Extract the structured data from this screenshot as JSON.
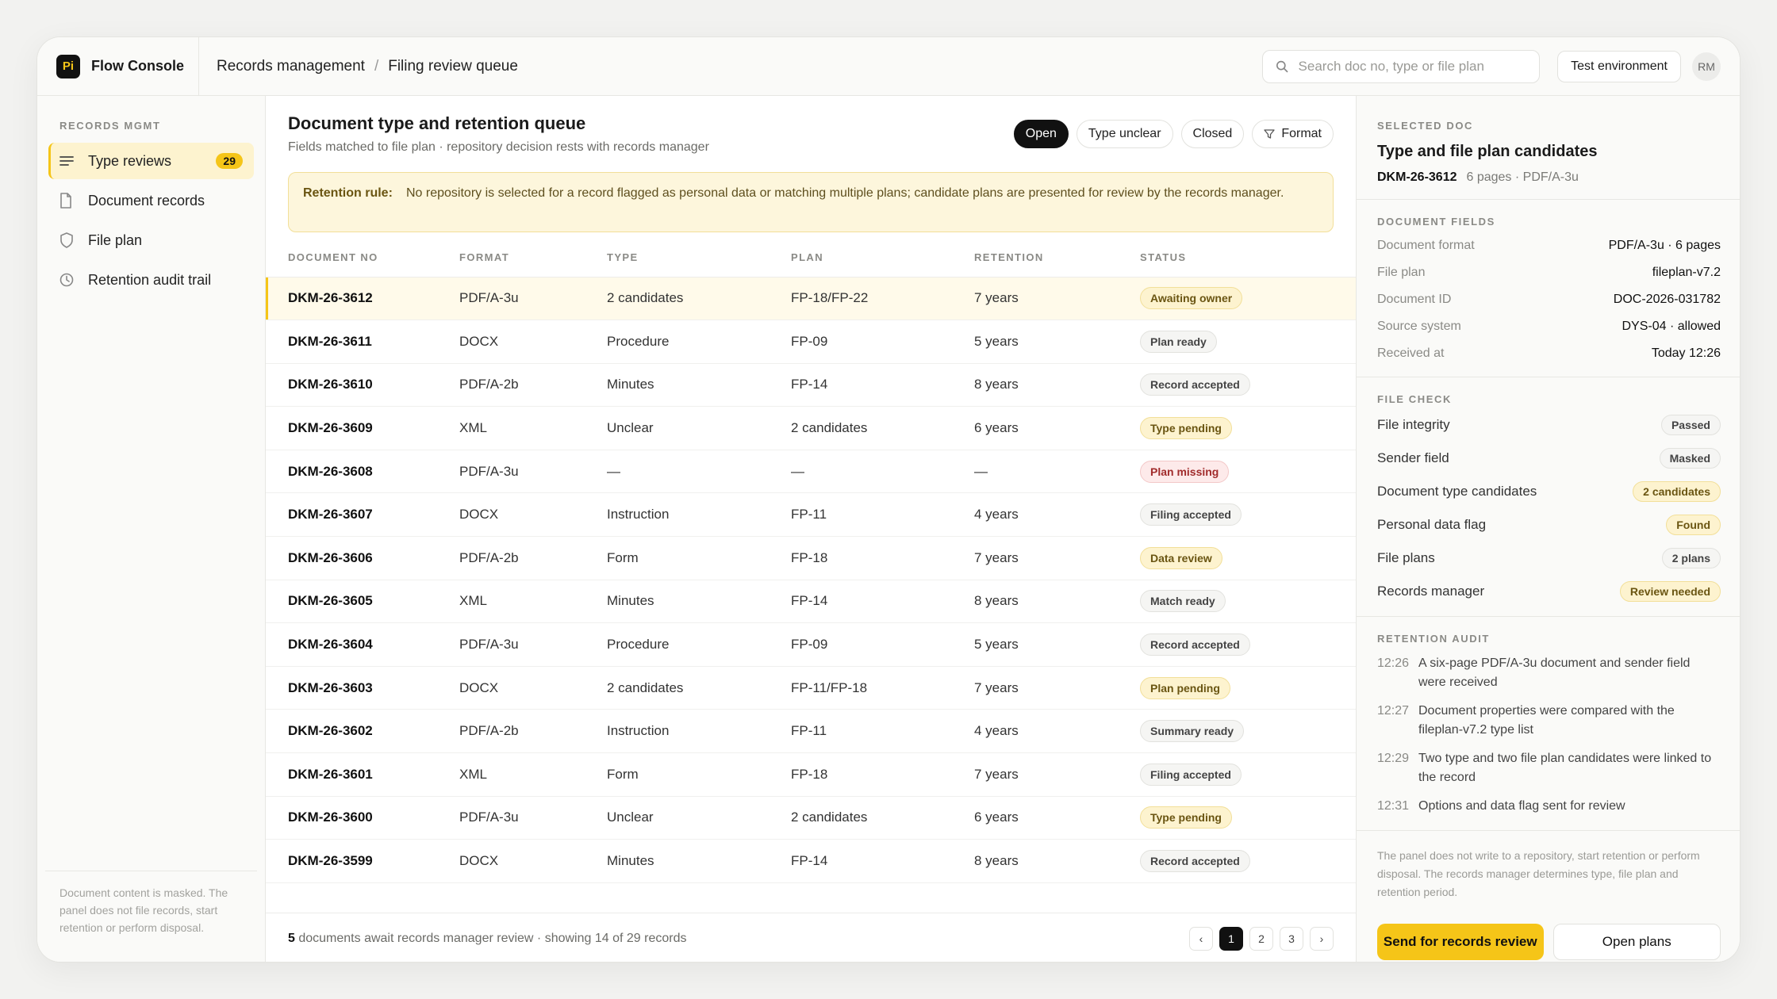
{
  "app": {
    "logo": "Pi",
    "name": "Flow Console"
  },
  "breadcrumb": {
    "root": "Records management",
    "separator": "/",
    "current": "Filing review queue"
  },
  "search": {
    "placeholder": "Search doc no, type or file plan"
  },
  "env_label": "Test environment",
  "avatar_initials": "RM",
  "sidebar": {
    "heading": "RECORDS MGMT",
    "items": [
      {
        "label": "Type reviews",
        "icon": "list-icon",
        "badge": "29",
        "active": true
      },
      {
        "label": "Document records",
        "icon": "document-icon"
      },
      {
        "label": "File plan",
        "icon": "shield-icon"
      },
      {
        "label": "Retention audit trail",
        "icon": "clock-icon"
      }
    ],
    "note": "Document content is masked. The panel does not file records, start retention or perform disposal."
  },
  "main": {
    "title": "Document type and retention queue",
    "subtitle": "Fields matched to file plan · repository decision rests with records manager",
    "filters": [
      "Open",
      "Type unclear",
      "Closed"
    ],
    "format_filter": "Format",
    "rule_label": "Retention rule:",
    "rule_text": "No repository is selected for a record flagged as personal data or matching multiple plans; candidate plans are presented for review by the records manager.",
    "columns": [
      "DOCUMENT NO",
      "FORMAT",
      "TYPE",
      "PLAN",
      "RETENTION",
      "STATUS"
    ],
    "rows": [
      {
        "doc": "DKM-26-3612",
        "format": "PDF/A-3u",
        "type": "2 candidates",
        "plan": "FP-18/FP-22",
        "retention": "7 years",
        "status": "Awaiting owner",
        "tone": "warn"
      },
      {
        "doc": "DKM-26-3611",
        "format": "DOCX",
        "type": "Procedure",
        "plan": "FP-09",
        "retention": "5 years",
        "status": "Plan ready",
        "tone": "neutral"
      },
      {
        "doc": "DKM-26-3610",
        "format": "PDF/A-2b",
        "type": "Minutes",
        "plan": "FP-14",
        "retention": "8 years",
        "status": "Record accepted",
        "tone": "neutral"
      },
      {
        "doc": "DKM-26-3609",
        "format": "XML",
        "type": "Unclear",
        "plan": "2 candidates",
        "retention": "6 years",
        "status": "Type pending",
        "tone": "warn"
      },
      {
        "doc": "DKM-26-3608",
        "format": "PDF/A-3u",
        "type": "—",
        "plan": "—",
        "retention": "—",
        "status": "Plan missing",
        "tone": "danger"
      },
      {
        "doc": "DKM-26-3607",
        "format": "DOCX",
        "type": "Instruction",
        "plan": "FP-11",
        "retention": "4 years",
        "status": "Filing accepted",
        "tone": "neutral"
      },
      {
        "doc": "DKM-26-3606",
        "format": "PDF/A-2b",
        "type": "Form",
        "plan": "FP-18",
        "retention": "7 years",
        "status": "Data review",
        "tone": "warn"
      },
      {
        "doc": "DKM-26-3605",
        "format": "XML",
        "type": "Minutes",
        "plan": "FP-14",
        "retention": "8 years",
        "status": "Match ready",
        "tone": "neutral"
      },
      {
        "doc": "DKM-26-3604",
        "format": "PDF/A-3u",
        "type": "Procedure",
        "plan": "FP-09",
        "retention": "5 years",
        "status": "Record accepted",
        "tone": "neutral"
      },
      {
        "doc": "DKM-26-3603",
        "format": "DOCX",
        "type": "2 candidates",
        "plan": "FP-11/FP-18",
        "retention": "7 years",
        "status": "Plan pending",
        "tone": "warn"
      },
      {
        "doc": "DKM-26-3602",
        "format": "PDF/A-2b",
        "type": "Instruction",
        "plan": "FP-11",
        "retention": "4 years",
        "status": "Summary ready",
        "tone": "neutral"
      },
      {
        "doc": "DKM-26-3601",
        "format": "XML",
        "type": "Form",
        "plan": "FP-18",
        "retention": "7 years",
        "status": "Filing accepted",
        "tone": "neutral"
      },
      {
        "doc": "DKM-26-3600",
        "format": "PDF/A-3u",
        "type": "Unclear",
        "plan": "2 candidates",
        "retention": "6 years",
        "status": "Type pending",
        "tone": "warn"
      },
      {
        "doc": "DKM-26-3599",
        "format": "DOCX",
        "type": "Minutes",
        "plan": "FP-14",
        "retention": "8 years",
        "status": "Record accepted",
        "tone": "neutral"
      }
    ],
    "footer_count": "5",
    "footer_text": " documents await records manager review · showing 14 of 29 records",
    "pages": [
      "1",
      "2",
      "3"
    ],
    "prev": "‹",
    "next": "›"
  },
  "panel": {
    "heading": "SELECTED DOC",
    "title": "Type and file plan candidates",
    "doc_no": "DKM-26-3612",
    "doc_meta": "6 pages · PDF/A-3u",
    "fields_heading": "DOCUMENT FIELDS",
    "fields": [
      {
        "k": "Document format",
        "v": "PDF/A-3u · 6 pages"
      },
      {
        "k": "File plan",
        "v": "fileplan-v7.2"
      },
      {
        "k": "Document ID",
        "v": "DOC-2026-031782"
      },
      {
        "k": "Source system",
        "v": "DYS-04 · allowed"
      },
      {
        "k": "Received at",
        "v": "Today 12:26"
      }
    ],
    "check_heading": "FILE CHECK",
    "checks": [
      {
        "k": "File integrity",
        "v": "Passed",
        "tone": "neutral"
      },
      {
        "k": "Sender field",
        "v": "Masked",
        "tone": "neutral"
      },
      {
        "k": "Document type candidates",
        "v": "2 candidates",
        "tone": "warn"
      },
      {
        "k": "Personal data flag",
        "v": "Found",
        "tone": "warn"
      },
      {
        "k": "File plans",
        "v": "2 plans",
        "tone": "neutral"
      },
      {
        "k": "Records manager",
        "v": "Review needed",
        "tone": "warn"
      }
    ],
    "audit_heading": "RETENTION AUDIT",
    "audit": [
      {
        "t": "12:26",
        "text": "A six-page PDF/A-3u document and sender field were received"
      },
      {
        "t": "12:27",
        "text": "Document properties were compared with the fileplan-v7.2 type list"
      },
      {
        "t": "12:29",
        "text": "Two type and two file plan candidates were linked to the record"
      },
      {
        "t": "12:31",
        "text": "Options and data flag sent for review"
      }
    ],
    "note": "The panel does not write to a repository, start retention or perform disposal. The records manager determines type, file plan and retention period.",
    "primary_action": "Send for records review",
    "secondary_action": "Open plans"
  }
}
